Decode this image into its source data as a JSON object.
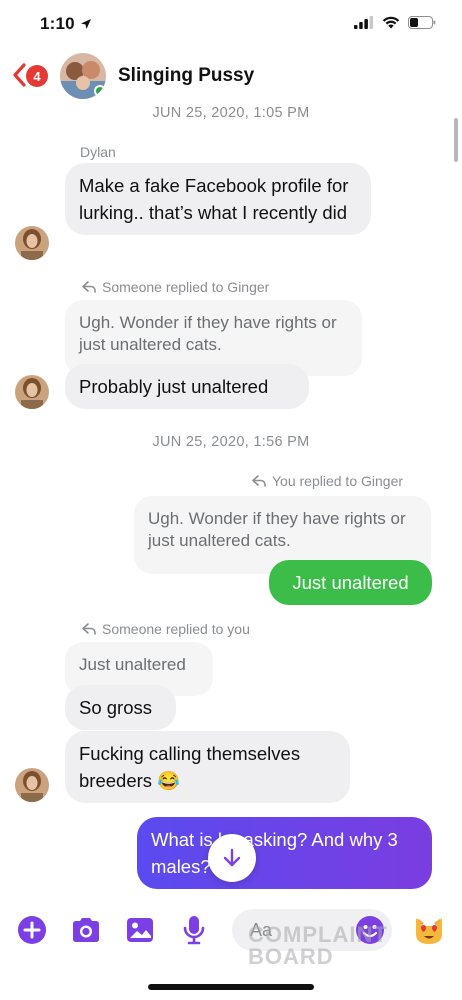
{
  "status_bar": {
    "time": "1:10",
    "location_icon": "location-arrow-icon",
    "signal_icon": "cellular-signal-icon",
    "wifi_icon": "wifi-icon",
    "battery_icon": "battery-low-icon"
  },
  "header": {
    "back_badge": "4",
    "title": "Slinging Pussy",
    "back_icon": "chevron-left-icon"
  },
  "messages": {
    "ts1": "JUN 25, 2020, 1:05 PM",
    "m1_sender": "Dylan",
    "m1_text": "Make a fake Facebook profile for lurking.. that’s what I recently did",
    "reply1_note": "Someone replied to Ginger",
    "reply1_quote": "Ugh. Wonder if they have rights or just unaltered cats.",
    "m2_text": "Probably just unaltered",
    "ts2": "JUN 25, 2020, 1:56 PM",
    "reply2_note": "You replied to Ginger",
    "reply2_quote": "Ugh. Wonder if they have rights or just unaltered cats.",
    "m3_text": "Just unaltered",
    "reply3_note": "Someone replied to you",
    "reply3_quote": "Just unaltered",
    "m4_text": "So gross",
    "m5_text": "Fucking calling themselves breeders 😂",
    "m6_text": "What is he asking? And why 3 males?"
  },
  "composer": {
    "placeholder": "Aa",
    "watermark_line1": "COMPLAINT",
    "watermark_line2": "BOARD",
    "icons": [
      "plus-circle-icon",
      "camera-icon",
      "image-icon",
      "microphone-icon",
      "emoji-smile-icon",
      "heart-eyes-cat-icon"
    ]
  },
  "colors": {
    "accent": "#7b3fe4",
    "outgoing_green": "#3cbd4a",
    "outgoing_blue_start": "#5a4bf0",
    "outgoing_blue_end": "#7a3de0",
    "incoming_bubble": "#efeff1",
    "badge_red": "#e53935"
  }
}
